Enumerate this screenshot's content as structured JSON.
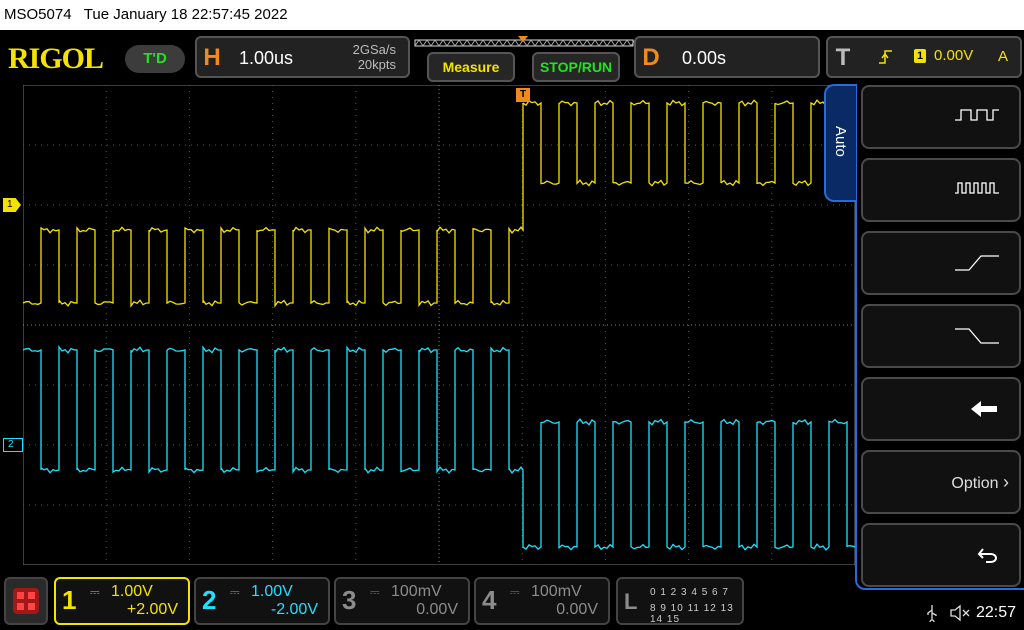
{
  "title_bar": {
    "model": "MSO5074",
    "datetime": "Tue January 18 22:57:45 2022"
  },
  "header": {
    "logo": "RIGOL",
    "trigger_status": "T'D",
    "horizontal": {
      "letter": "H",
      "timebase": "1.00us",
      "sample_rate": "2GSa/s",
      "memory_depth": "20kpts"
    },
    "measure_label": "Measure",
    "run_label": "STOP/RUN",
    "delay": {
      "letter": "D",
      "value": "0.00s"
    },
    "trigger": {
      "letter": "T",
      "channel": "1",
      "level": "0.00V",
      "mode": "A"
    }
  },
  "side_menu": {
    "tab_label": "Auto",
    "option_label": "Option"
  },
  "channels": [
    {
      "number": "1",
      "scale": "1.00V",
      "offset": "+2.00V",
      "color": "#f4e300"
    },
    {
      "number": "2",
      "scale": "1.00V",
      "offset": "-2.00V",
      "color": "#1ee0ff"
    },
    {
      "number": "3",
      "scale": "100mV",
      "offset": "0.00V",
      "color": "#8c8c8c"
    },
    {
      "number": "4",
      "scale": "100mV",
      "offset": "0.00V",
      "color": "#8c8c8c"
    }
  ],
  "digital": {
    "letter": "L",
    "row1": "0 1 2 3   4 5 6 7",
    "row2": "8 9 10 11 12 13 14 15"
  },
  "status": {
    "clock": "22:57"
  },
  "markers": {
    "ch1": "1",
    "ch2": "2",
    "trigger": "T"
  },
  "colors": {
    "ch1": "#f4e300",
    "ch2": "#1ee0ff",
    "accent": "#2a6bd6",
    "orange": "#f08a1c"
  }
}
